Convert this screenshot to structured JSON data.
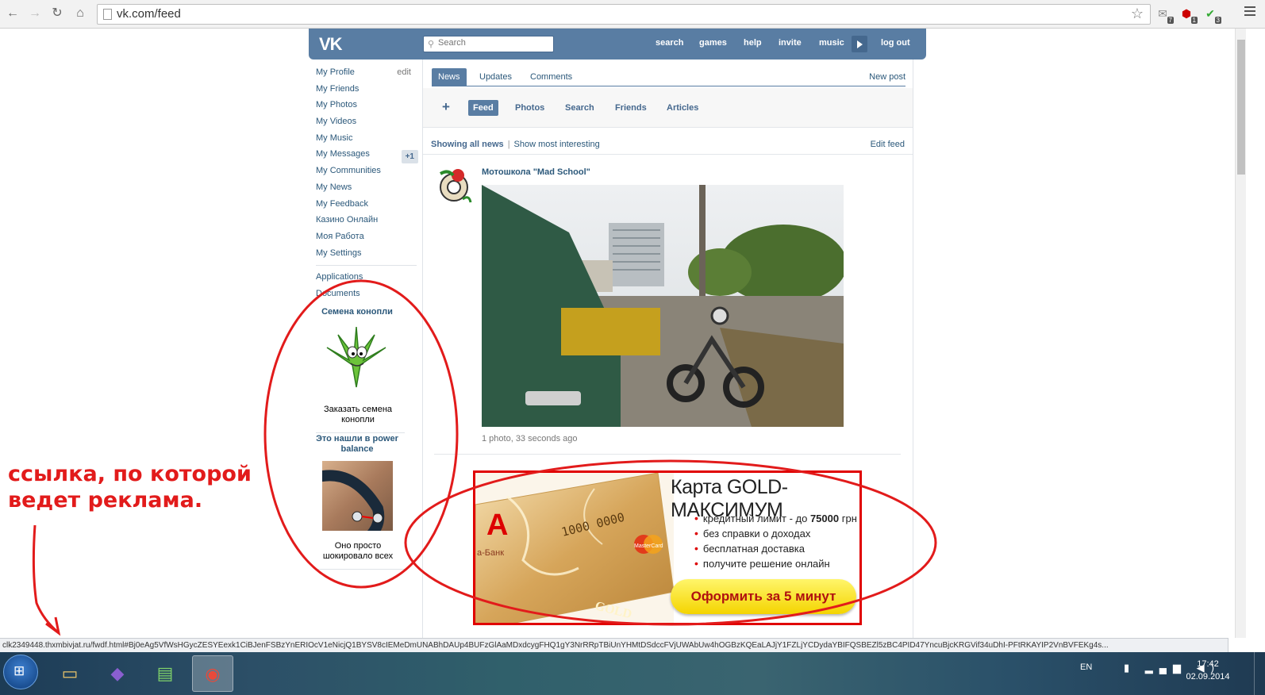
{
  "browser": {
    "url": "vk.com/feed",
    "extensions": [
      {
        "name": "gmail-extension-icon",
        "glyph": "✉",
        "badge": "7"
      },
      {
        "name": "adblock-extension-icon",
        "glyph": "⬢",
        "badge": "1"
      },
      {
        "name": "shield-extension-icon",
        "glyph": "✔",
        "badge": "3"
      }
    ]
  },
  "vk_header": {
    "logo": "VK",
    "search_placeholder": "Search",
    "nav": [
      "search",
      "games",
      "help",
      "invite",
      "music",
      "log out"
    ]
  },
  "left_menu": {
    "items": [
      {
        "label": "My Profile",
        "extra": "edit"
      },
      {
        "label": "My Friends"
      },
      {
        "label": "My Photos"
      },
      {
        "label": "My Videos"
      },
      {
        "label": "My Music"
      },
      {
        "label": "My Messages",
        "count": "+1"
      },
      {
        "label": "My Communities"
      },
      {
        "label": "My News"
      },
      {
        "label": "My Feedback"
      },
      {
        "label": "Казино Онлайн"
      },
      {
        "label": "Моя Работа"
      },
      {
        "label": "My Settings"
      }
    ],
    "secondary": [
      "Applications",
      "Documents"
    ]
  },
  "left_ads": [
    {
      "title": "Семена конопли",
      "text": "Заказать семена конопли"
    },
    {
      "title": "Это нашли в power balance",
      "text": "Оно просто шокировало всех"
    }
  ],
  "feed": {
    "tabs": [
      "News",
      "Updates",
      "Comments"
    ],
    "new_post": "New post",
    "subtabs": [
      "Feed",
      "Photos",
      "Search",
      "Friends",
      "Articles"
    ],
    "showing": "Showing all news",
    "show_interesting": "Show most interesting",
    "edit_feed": "Edit feed",
    "post": {
      "author": "Мотошкола \"Mad School\"",
      "meta": "1 photo, 33 seconds ago"
    }
  },
  "banner": {
    "title": "Карта GOLD-МАКСИМУМ",
    "bullets": [
      {
        "pre": "кредитный лимит - до ",
        "bold": "75000",
        "post": " грн"
      },
      {
        "pre": "без справки о доходах",
        "bold": "",
        "post": ""
      },
      {
        "pre": "бесплатная доставка",
        "bold": "",
        "post": ""
      },
      {
        "pre": "получите решение онлайн",
        "bold": "",
        "post": ""
      }
    ],
    "cta": "Оформить за 5 минут",
    "card_bank": "а-Банк",
    "card_gold": "GOLD",
    "card_number": "1000 0000",
    "card_brand": "MasterCard"
  },
  "annotation": {
    "line1": "ссылка, по которой",
    "line2": "ведет реклама."
  },
  "status_url": "clk2349448.thxmbivjat.ru/fwdf.html#Bj0eAg5VfWsHGycZESYEexk1CiBJenFSBzYnERIOcV1eNicjQ1BYSV8cIEMeDmUNABhDAUp4BUFzGlAaMDxdcygFHQ1gY3NrRRpTBiUnYHMtDSdccFVjUWAbUw4hOGBzKQEaLAJjY1FZLjYCDydaYBIFQSBEZl5zBC4PID47YncuBjcKRGVif34uDhI-PFtRKAYIP2VnBVFEKg4s...",
  "taskbar": {
    "lang": "EN",
    "time": "17:42",
    "date": "02.09.2014",
    "apps": [
      {
        "name": "explorer",
        "glyph": "📁",
        "color": "#e8c26a"
      },
      {
        "name": "visual-studio",
        "glyph": "◆",
        "color": "#8a5fd0"
      },
      {
        "name": "task-manager",
        "glyph": "▤",
        "color": "#7fd16a"
      },
      {
        "name": "chrome",
        "glyph": "◉",
        "color": "#e84a3a"
      }
    ]
  },
  "colors": {
    "vk_blue": "#597da3",
    "link": "#2b587a",
    "annotation_red": "#e21b1b"
  }
}
